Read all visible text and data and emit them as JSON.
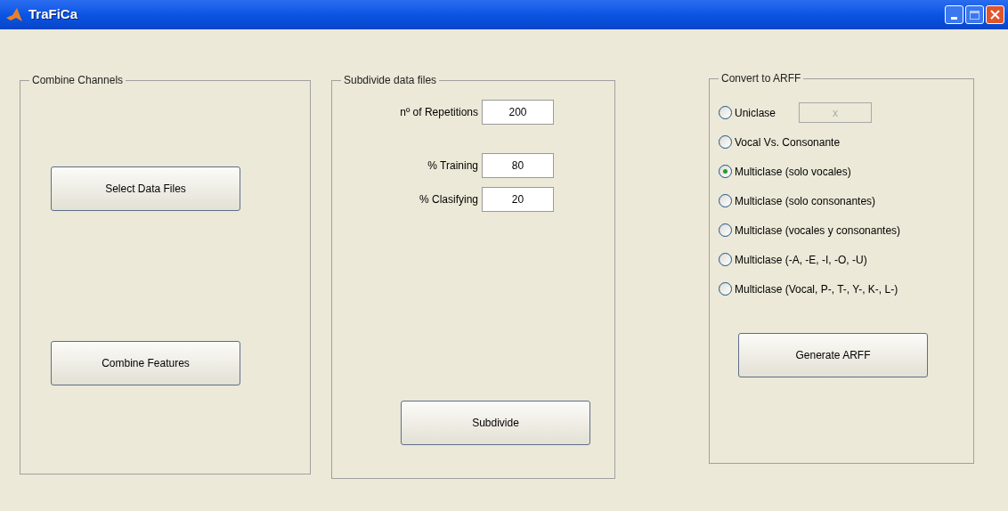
{
  "window": {
    "title": "TraFiCa"
  },
  "combine_channels": {
    "title": "Combine Channels",
    "buttons": [
      "Select Data Files",
      "Combine Features"
    ]
  },
  "subdivide": {
    "title": "Subdivide data files",
    "fields": [
      {
        "label": "nº of Repetitions",
        "value": "200"
      },
      {
        "label": "% Training",
        "value": "80"
      },
      {
        "label": "% Clasifying",
        "value": "20"
      }
    ],
    "button": "Subdivide"
  },
  "convert": {
    "title": "Convert to ARFF",
    "options": [
      {
        "label": "Uniclase",
        "selected": false,
        "field": {
          "value": "x",
          "disabled": true
        }
      },
      {
        "label": "Vocal Vs. Consonante",
        "selected": false
      },
      {
        "label": "Multiclase (solo vocales)",
        "selected": true
      },
      {
        "label": "Multiclase (solo consonantes)",
        "selected": false
      },
      {
        "label": "Multiclase (vocales y consonantes)",
        "selected": false
      },
      {
        "label": "Multiclase (-A, -E, -I, -O, -U)",
        "selected": false
      },
      {
        "label": "Multiclase (Vocal, P-, T-, Y-, K-, L-)",
        "selected": false
      }
    ],
    "button": "Generate ARFF"
  }
}
